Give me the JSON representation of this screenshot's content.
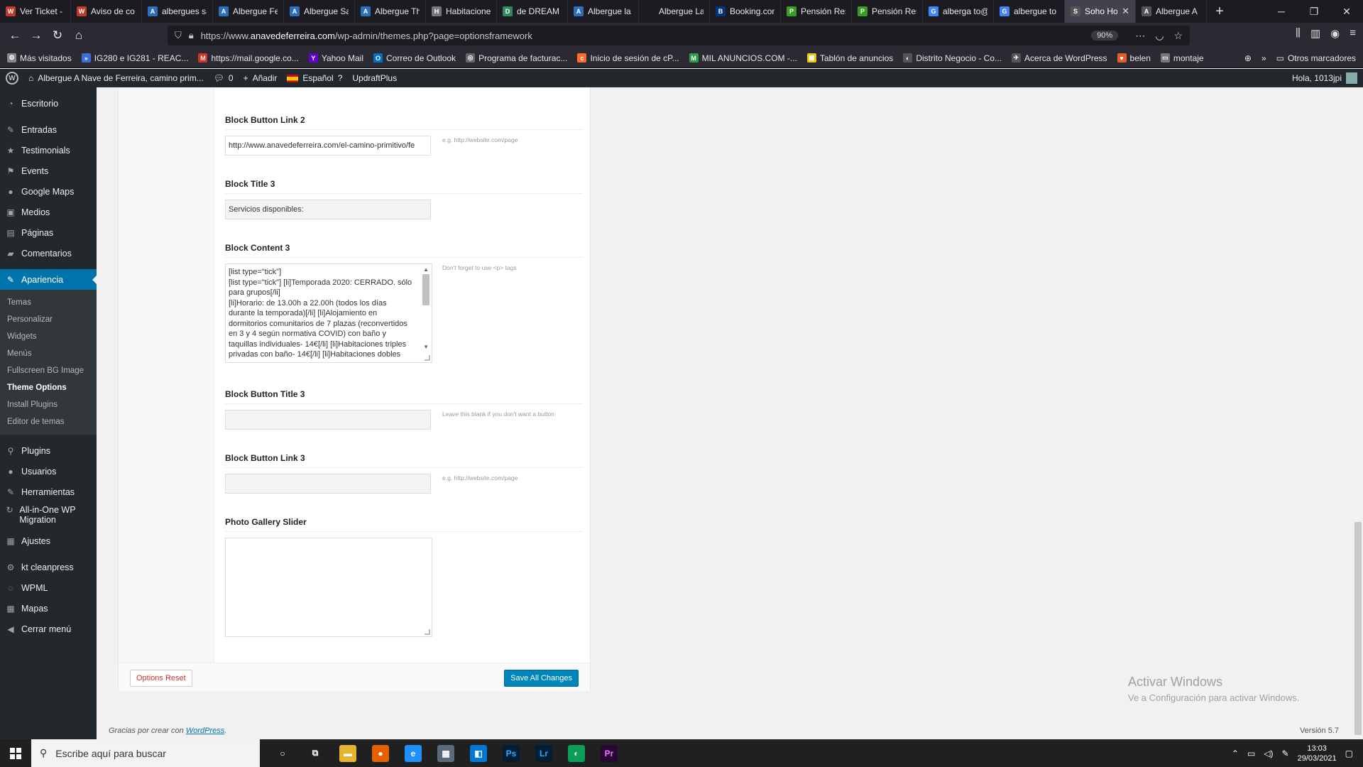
{
  "browser": {
    "tabs": [
      {
        "label": "Ver Ticket -",
        "color": "#c0392b",
        "glyph": "W"
      },
      {
        "label": "Aviso de co",
        "color": "#c0392b",
        "glyph": "W"
      },
      {
        "label": "albergues sa",
        "color": "#2c6fbb",
        "glyph": "A"
      },
      {
        "label": "Albergue Fe",
        "color": "#2c6fbb",
        "glyph": "A"
      },
      {
        "label": "Albergue Sa",
        "color": "#2c6fbb",
        "glyph": "A"
      },
      {
        "label": "Albergue Th",
        "color": "#2c6fbb",
        "glyph": "A"
      },
      {
        "label": "Habitacione",
        "color": "#777777",
        "glyph": "H"
      },
      {
        "label": "de DREAM",
        "color": "#2e8b57",
        "glyph": "D"
      },
      {
        "label": "Albergue la",
        "color": "#2c6fbb",
        "glyph": "A"
      },
      {
        "label": "Albergue La Esta",
        "color": "#1c1b22",
        "glyph": ""
      },
      {
        "label": "Booking.com",
        "color": "#003580",
        "glyph": "B"
      },
      {
        "label": "Pensión Resi",
        "color": "#3a9d23",
        "glyph": "P"
      },
      {
        "label": "Pensión Resi",
        "color": "#3a9d23",
        "glyph": "P"
      },
      {
        "label": "alberga to@",
        "color": "#4285f4",
        "glyph": "G"
      },
      {
        "label": "albergue to",
        "color": "#4285f4",
        "glyph": "G"
      },
      {
        "label": "Soho Ho",
        "color": "#555555",
        "glyph": "S",
        "active": true
      },
      {
        "label": "Albergue A",
        "color": "#555555",
        "glyph": "A"
      }
    ],
    "new_tab": "+",
    "url_prefix": "https://www.",
    "url_domain": "anavedeferreira.com",
    "url_path": "/wp-admin/themes.php?page=optionsframework",
    "zoom": "90%",
    "bookmarks": [
      {
        "label": "Más visitados",
        "color": "#888888",
        "glyph": "⚙"
      },
      {
        "label": "IG280 e IG281 - REAC...",
        "color": "#3a6fd8",
        "glyph": "»"
      },
      {
        "label": "https://mail.google.co...",
        "color": "#d93025",
        "glyph": "M"
      },
      {
        "label": "Yahoo Mail",
        "color": "#6001d2",
        "glyph": "Y"
      },
      {
        "label": "Correo de Outlook",
        "color": "#0072c6",
        "glyph": "O"
      },
      {
        "label": "Programa de facturac...",
        "color": "#666666",
        "glyph": "◎"
      },
      {
        "label": "Inicio de sesión de cP...",
        "color": "#ff6c2c",
        "glyph": "c"
      },
      {
        "label": "MIL ANUNCIOS.COM -...",
        "color": "#2e9e44",
        "glyph": "M"
      },
      {
        "label": "Tablón de anuncios",
        "color": "#f4c20d",
        "glyph": "▦"
      },
      {
        "label": "Distrito Negocio - Co...",
        "color": "#555555",
        "glyph": "◐"
      },
      {
        "label": "Acerca de WordPress",
        "color": "#555555",
        "glyph": "✈"
      },
      {
        "label": "belen",
        "color": "#e35d2b",
        "glyph": "♥"
      },
      {
        "label": "montaje",
        "color": "#777777",
        "glyph": "▭"
      }
    ],
    "other_bookmarks": "Otros marcadores"
  },
  "adminbar": {
    "site_name": "Albergue A Nave de Ferreira, camino prim...",
    "comments_count": "0",
    "add_new": "Añadir",
    "language": "Español",
    "updraft": "UpdraftPlus",
    "greeting": "Hola, 1013jpi"
  },
  "sidebar": {
    "items_top": [
      {
        "label": "Escritorio",
        "icon": "◔"
      },
      {
        "label": "Entradas",
        "icon": "✎"
      },
      {
        "label": "Testimonials",
        "icon": "★"
      },
      {
        "label": "Events",
        "icon": "⚑"
      },
      {
        "label": "Google Maps",
        "icon": "●"
      },
      {
        "label": "Medios",
        "icon": "▣"
      },
      {
        "label": "Páginas",
        "icon": "▤"
      },
      {
        "label": "Comentarios",
        "icon": "▰"
      }
    ],
    "current": {
      "label": "Apariencia",
      "icon": "✎"
    },
    "submenu": [
      {
        "label": "Temas"
      },
      {
        "label": "Personalizar"
      },
      {
        "label": "Widgets"
      },
      {
        "label": "Menús"
      },
      {
        "label": "Fullscreen BG Image"
      },
      {
        "label": "Theme Options",
        "active": true
      },
      {
        "label": "Install Plugins"
      },
      {
        "label": "Editor de temas"
      }
    ],
    "items_bottom": [
      {
        "label": "Plugins",
        "icon": "⚲"
      },
      {
        "label": "Usuarios",
        "icon": "●"
      },
      {
        "label": "Herramientas",
        "icon": "✎"
      }
    ],
    "migration": {
      "label": "All-in-One WP Migration",
      "icon": "↻"
    },
    "items_end": [
      {
        "label": "Ajustes",
        "icon": "▦"
      },
      {
        "label": "kt cleanpress",
        "icon": "⚙"
      },
      {
        "label": "WPML",
        "icon": "◌"
      },
      {
        "label": "Mapas",
        "icon": "▦"
      },
      {
        "label": "Cerrar menú",
        "icon": "◀"
      }
    ]
  },
  "options": {
    "block_button_link_2": {
      "title": "Block Button Link 2",
      "value": "http://www.anavedeferreira.com/el-camino-primitivo/fe",
      "hint": "e.g. http://website.com/page"
    },
    "block_title_3": {
      "title": "Block Title 3",
      "value": "Servicios disponibles:"
    },
    "block_content_3": {
      "title": "Block Content 3",
      "hint": "Don't forget to use <p> tags",
      "lines": [
        "[list type=\"tick\"]",
        "[list type=\"tick\"] [li]Temporada 2020: CERRADO. sólo",
        "para grupos[/li]",
        "[li]Horario: de 13.00h a 22.00h (todos los días",
        "durante la temporada)[/li] [li]Alojamiento en",
        "dormitorios comunitarios de 7 plazas (reconvertidos",
        "en 3 y 4 según normativa COVID) con  baño y",
        "taquillas individuales- 14€[/li] [li]Habitaciones triples",
        "privadas con baño- 14€[/li] [li]Habitaciones dobles"
      ]
    },
    "block_button_title_3": {
      "title": "Block Button Title 3",
      "value": "",
      "hint": "Leave this blank if you don't want a button"
    },
    "block_button_link_3": {
      "title": "Block Button Link 3",
      "value": "",
      "hint": "e.g. http://website.com/page"
    },
    "photo_gallery_slider": {
      "title": "Photo Gallery Slider"
    },
    "reset_label": "Options Reset",
    "save_label": "Save All Changes"
  },
  "footer": {
    "thanks_prefix": "Gracias por crear con ",
    "thanks_link": "WordPress",
    "thanks_suffix": ".",
    "version": "Versión 5.7"
  },
  "watermark": {
    "line1": "Activar Windows",
    "line2": "Ve a Configuración para activar Windows."
  },
  "taskbar": {
    "search_placeholder": "Escribe aquí para buscar",
    "apps": [
      {
        "name": "cortana",
        "glyph": "○",
        "color": "transparent"
      },
      {
        "name": "task-view",
        "glyph": "⧉",
        "color": "transparent"
      },
      {
        "name": "file-explorer",
        "glyph": "▬",
        "color": "#e8b430"
      },
      {
        "name": "firefox",
        "glyph": "●",
        "color": "#e66000"
      },
      {
        "name": "internet-explorer",
        "glyph": "e",
        "color": "#1e90ff"
      },
      {
        "name": "calculator",
        "glyph": "▦",
        "color": "#5a6a7a"
      },
      {
        "name": "store",
        "glyph": "◧",
        "color": "#0078d7"
      },
      {
        "name": "photoshop",
        "glyph": "Ps",
        "color": "#001e36"
      },
      {
        "name": "lightroom",
        "glyph": "Lr",
        "color": "#001e36"
      },
      {
        "name": "edge",
        "glyph": "◐",
        "color": "#0c9d58"
      },
      {
        "name": "premiere",
        "glyph": "Pr",
        "color": "#2a0634"
      }
    ],
    "time": "13:03",
    "date": "29/03/2021"
  }
}
